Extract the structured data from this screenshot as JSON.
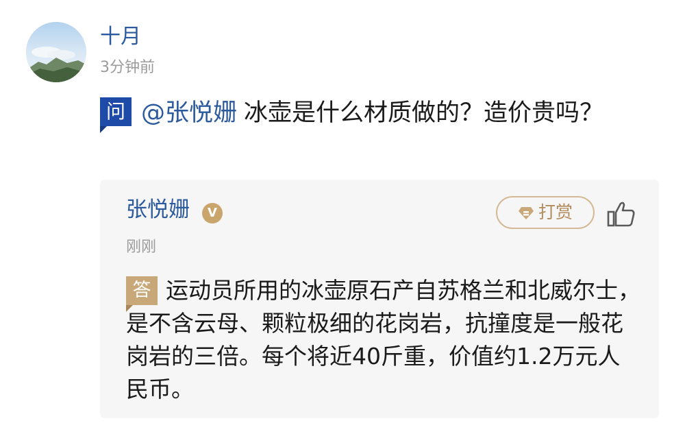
{
  "comment": {
    "username": "十月",
    "time": "3分钟前",
    "avatar_icon": "landscape-avatar"
  },
  "question": {
    "badge": "问",
    "mention": "@张悦姗",
    "text": "冰壶是什么材质做的？造价贵吗？"
  },
  "answer": {
    "author": "张悦姗",
    "verified_badge": "V",
    "time": "刚刚",
    "tip_button_label": "打赏",
    "tip_icon": "diamond-icon",
    "like_icon": "thumbs-up-icon",
    "badge": "答",
    "text": "运动员所用的冰壶原石产自苏格兰和北威尔士，是不含云母、颗粒极细的花岗岩，抗撞度是一般花岗岩的三倍。每个将近40斤重，价值约1.2万元人民币。"
  },
  "colors": {
    "link_blue": "#2b5a9e",
    "question_badge": "#1e4aa8",
    "answer_badge": "#c8a878",
    "tip_gold": "#b28a5c",
    "card_bg": "#f6f6f6",
    "meta_gray": "#9b9b9b"
  }
}
